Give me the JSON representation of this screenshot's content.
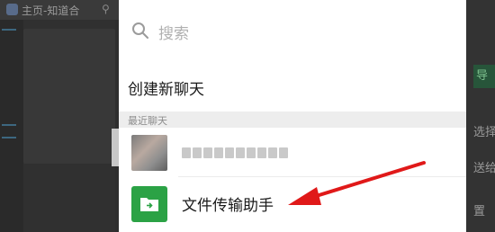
{
  "background": {
    "topbar": {
      "home_label": "主页-知道合",
      "link_icon": "link-icon"
    },
    "right_pane": {
      "button_label": "导",
      "text1": "选择",
      "text2": "送给",
      "text3": "置"
    }
  },
  "picker": {
    "search_placeholder": "搜索",
    "new_chat_label": "创建新聊天",
    "recent_section_label": "最近聊天",
    "contacts": [
      {
        "name": "(blurred)",
        "avatar": "blurred-avatar"
      },
      {
        "name": "文件传输助手",
        "avatar": "folder-icon"
      }
    ]
  },
  "colors": {
    "accent_green": "#2ba245",
    "annotation_red": "#e01919",
    "overlay_dark": "#2e2e2e"
  }
}
